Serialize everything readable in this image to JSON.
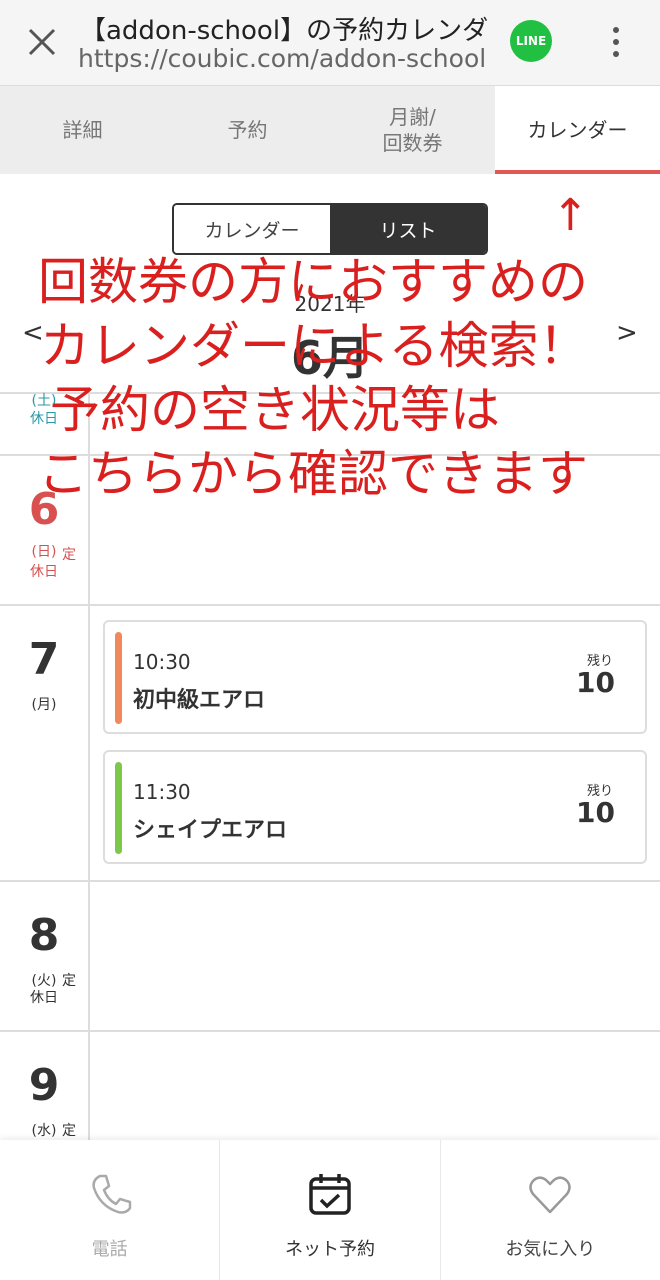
{
  "browser": {
    "title": "【addon-school】の予約カレンダ…",
    "url": "https://coubic.com/addon-school",
    "line_label": "LINE"
  },
  "tabs": [
    {
      "label": "詳細"
    },
    {
      "label": "予約"
    },
    {
      "label": "月謝/\n回数券"
    },
    {
      "label": "カレンダー",
      "active": true
    }
  ],
  "view_toggle": {
    "calendar": "カレンダー",
    "list": "リスト"
  },
  "calendar": {
    "year": "2021年",
    "month": "6月",
    "prev": "<",
    "next": ">",
    "days": [
      {
        "num": "",
        "weekday": "(土)",
        "status": "休日"
      },
      {
        "num": "6",
        "weekday": "(日)",
        "status": "定\n休日"
      },
      {
        "num": "7",
        "weekday": "(月)",
        "status": ""
      },
      {
        "num": "8",
        "weekday": "(火)",
        "status": "定\n休日"
      },
      {
        "num": "9",
        "weekday": "(水)",
        "status": "定"
      }
    ],
    "slots": [
      {
        "time": "10:30",
        "name": "初中級エアロ",
        "remaining_label": "残り",
        "remaining": "10",
        "color": "#f08a5d"
      },
      {
        "time": "11:30",
        "name": "シェイプエアロ",
        "remaining_label": "残り",
        "remaining": "10",
        "color": "#7dc84a"
      }
    ]
  },
  "annotation": {
    "arrow": "↑",
    "lines": [
      "回数券の方におすすめの",
      "カレンダーによる検索！",
      "予約の空き状況等は",
      "こちらから確認できます"
    ],
    "color": "#d9201f"
  },
  "bottom_nav": {
    "phone": "電話",
    "reserve": "ネット予約",
    "favorite": "お気に入り"
  },
  "colors": {
    "accent": "#e25656",
    "line_green": "#21c043"
  }
}
